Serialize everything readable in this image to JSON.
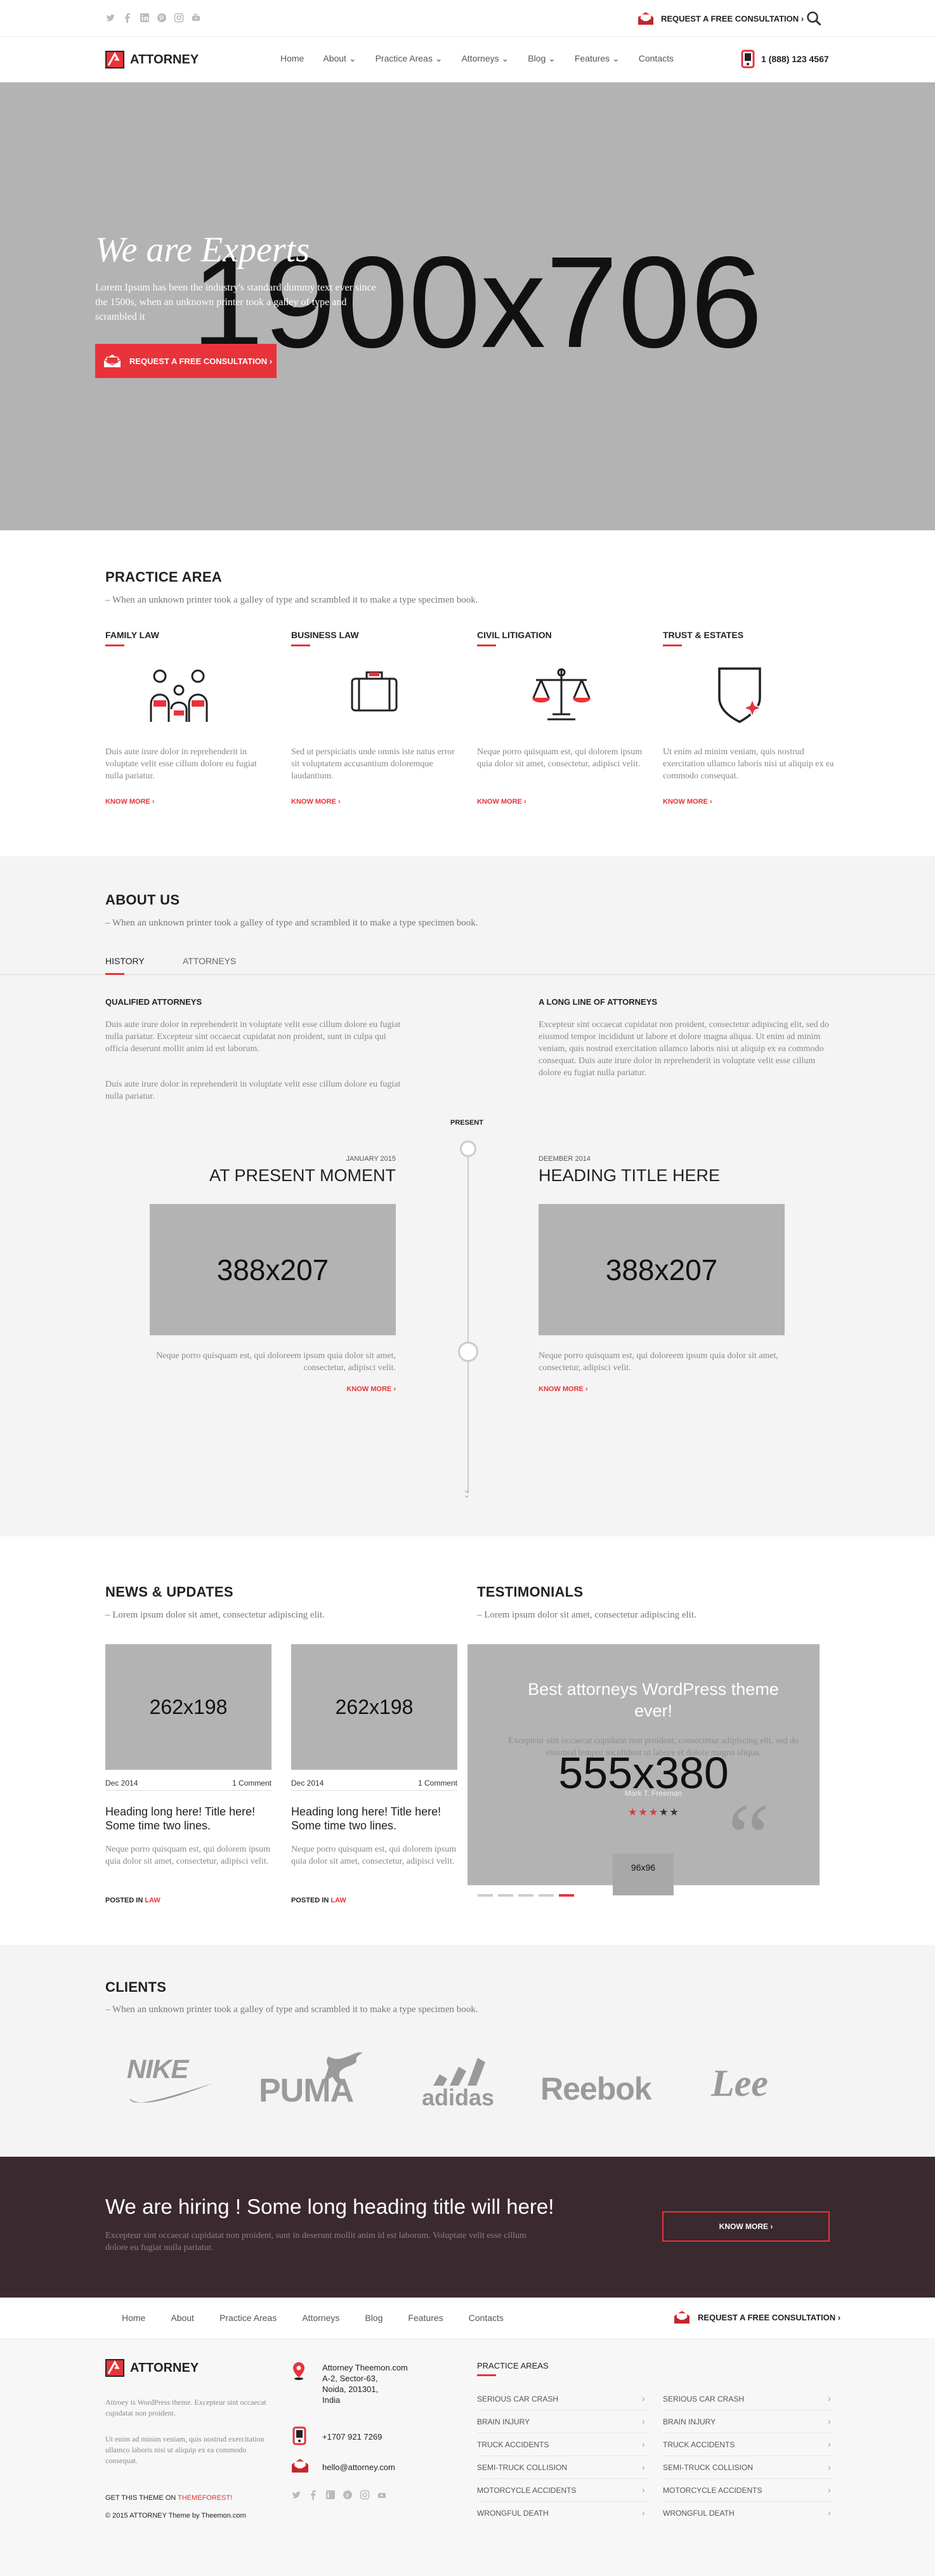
{
  "colors": {
    "accent": "#e8333a",
    "placeholder": "#b3b3b3",
    "hiring_bg": "#3a2a2f"
  },
  "topbar": {
    "social_icons": [
      "twitter-icon",
      "facebook-icon",
      "linkedin-icon",
      "pinterest-icon",
      "instagram-icon",
      "youtube-icon"
    ],
    "cta": "REQUEST A FREE CONSULTATION ›"
  },
  "nav": {
    "logo": "ATTORNEY",
    "items": [
      "Home",
      "About ⌄",
      "Practice Areas ⌄",
      "Attorneys ⌄",
      "Blog ⌄",
      "Features ⌄",
      "Contacts"
    ],
    "phone": "1 (888) 123 4567"
  },
  "hero": {
    "placeholder": "1900x706",
    "title": "We are Experts",
    "text": "Lorem Ipsum has been the industry's standard dummy text ever since the 1500s, when an unknown printer took a galley of type and scrambled it",
    "button": "REQUEST A FREE CONSULTATION ›"
  },
  "practice": {
    "title": "PRACTICE AREA",
    "subtitle": "– When an unknown printer took a galley of type and scrambled it to make a type specimen book.",
    "items": [
      {
        "title": "FAMILY LAW",
        "icon": "family-icon",
        "text": "Duis aute irure dolor in reprehenderit in voluptate velit esse cillum dolore eu fugiat nulla pariatur.",
        "more": "KNOW MORE ›"
      },
      {
        "title": "BUSINESS LAW",
        "icon": "briefcase-icon",
        "text": "Sed ut perspiciatis unde omnis iste natus error sit voluptatem accusantium doloremque laudantium.",
        "more": "KNOW MORE ›"
      },
      {
        "title": "CIVIL LITIGATION",
        "icon": "scales-icon",
        "text": "Neque porro quisquam est, qui dolorem ipsum quia dolor sit amet, consectetur, adipisci velit.",
        "more": "KNOW MORE ›"
      },
      {
        "title": "TRUST & ESTATES",
        "icon": "shield-icon",
        "text": "Ut enim ad minim veniam, quis nostrud exercitation ullamco laboris nisi ut aliquip ex ea commodo consequat.",
        "more": "KNOW MORE ›"
      }
    ]
  },
  "about": {
    "title": "ABOUT US",
    "subtitle": "– When an unknown printer took a galley of type and scrambled it to make a type specimen book.",
    "tabs": [
      "HISTORY",
      "ATTORNEYS"
    ],
    "col1": {
      "title": "QUALIFIED ATTORNEYS",
      "p1": "Duis aute irure dolor in reprehenderit in voluptate velit esse cillum dolore eu fugiat nulla pariatur. Excepteur sint occaecat cupidatat non proident, sunt in culpa qui officia deserunt mollit anim id est laborum.",
      "p2": "Duis aute irure dolor in reprehenderit in voluptate velit esse cillum dolore eu fugiat nulla pariatur."
    },
    "col2": {
      "title": "A LONG LINE OF ATTORNEYS",
      "p1": "Excepteur sint occaecat cupidatat non proident, consectetur adipiscing elit, sed do eiusmod tempor incididunt ut labore et dolore magna aliqua. Ut enim ad minim veniam, quis nostrud exercitation ullamco laboris nisi ut aliquip ex ea commodo consequat. Duis aute irure dolor in reprehenderit in voluptate velit esse cillum dolore eu fugiat nulla pariatur."
    },
    "timeline": {
      "present": "PRESENT",
      "left": {
        "date": "JANUARY 2015",
        "title": "AT PRESENT MOMENT",
        "placeholder": "388x207",
        "text": "Neque porro quisquam est, qui doloreem ipsum quia dolor sit amet, consectetur, adipisci velit.",
        "more": "KNOW MORE ›"
      },
      "right": {
        "date": "DEEMBER 2014",
        "title": "HEADING TITLE HERE",
        "placeholder": "388x207",
        "text": "Neque porro quisquam est, qui doloreem ipsum quia dolor sit amet, consectetur, adipisci velit.",
        "more": "KNOW MORE ›"
      }
    }
  },
  "news": {
    "title": "NEWS & UPDATES",
    "subtitle": "– Lorem ipsum dolor sit amet, consectetur adipiscing elit.",
    "items": [
      {
        "placeholder": "262x198",
        "date": "Dec 2014",
        "comments": "1 Comment",
        "title": "Heading long here! Title here! Some time two lines.",
        "text": "Neque porro quisquam est, qui dolorem ipsum quia dolor sit amet, consectetur, adipisci velit.",
        "posted": "POSTED IN",
        "category": "LAW"
      },
      {
        "placeholder": "262x198",
        "date": "Dec 2014",
        "comments": "1 Comment",
        "title": "Heading long here! Title here! Some time two lines.",
        "text": "Neque porro quisquam est, qui dolorem ipsum quia dolor sit amet, consectetur, adipisci velit.",
        "posted": "POSTED IN",
        "category": "LAW"
      }
    ]
  },
  "testimonials": {
    "title": "TESTIMONIALS",
    "subtitle": "– Lorem ipsum dolor sit amet, consectetur adipiscing elit.",
    "placeholder": "555x380",
    "quote": "Best attorneys WordPress theme ever!",
    "text": "Excepteur sint occaecat cupidatat non proident, consectetur adipiscing elit, sed do eiusmod tempor incididunt ut labore et dolore magna aliqua.",
    "author": "Mark T. Freeman",
    "rating": 3,
    "max_rating": 5,
    "avatar": "96x96",
    "dots": 5,
    "active_dot": 5
  },
  "clients": {
    "title": "CLIENTS",
    "subtitle": "– When an unknown printer took a galley of type and scrambled it to make a type specimen book.",
    "logos": [
      "NIKE",
      "PUMA",
      "adidas",
      "Reebok",
      "Lee"
    ]
  },
  "hiring": {
    "title": "We are hiring ! Some long heading title will here!",
    "text": "Excepteur sint occaecat cupidatat non proident, sunt in deserunt mollit anim id est laborum. Voluptate velit esse cillum dolore eu fugiat nulla pariatur.",
    "button": "KNOW MORE ›"
  },
  "footer_nav": {
    "items": [
      "Home",
      "About",
      "Practice Areas",
      "Attorneys",
      "Blog",
      "Features",
      "Contacts"
    ],
    "cta": "REQUEST A FREE CONSULTATION ›"
  },
  "footer": {
    "logo": "ATTORNEY",
    "about1": "Attroey is WordPress theme. Excepteur sint occaecat cupidatat non proident.",
    "about2": "Ut enim ad minim veniam, quis nostrud exercitation ullamco laboris nisi ut aliquip ex ea commodo consequat.",
    "get_theme": "GET THIS THEME ON",
    "themeforest": "THEMEFOREST!",
    "copyright": "© 2015 ATTORNEY Theme by Theemon.com",
    "address_lines": [
      "Attorney Theemon.com",
      "A-2, Sector-63,",
      "Noida, 201301,",
      "India"
    ],
    "phone": "+1707 921 7269",
    "email": "hello@attorney.com",
    "practice_title": "PRACTICE AREAS",
    "col1": [
      "SERIOUS CAR CRASH",
      "BRAIN INJURY",
      "TRUCK ACCIDENTS",
      "SEMI-TRUCK COLLISION",
      "MOTORCYCLE ACCIDENTS",
      "WRONGFUL DEATH"
    ],
    "col2": [
      "SERIOUS CAR CRASH",
      "BRAIN INJURY",
      "TRUCK ACCIDENTS",
      "SEMI-TRUCK COLLISION",
      "MOTORCYCLE ACCIDENTS",
      "WRONGFUL DEATH"
    ]
  }
}
